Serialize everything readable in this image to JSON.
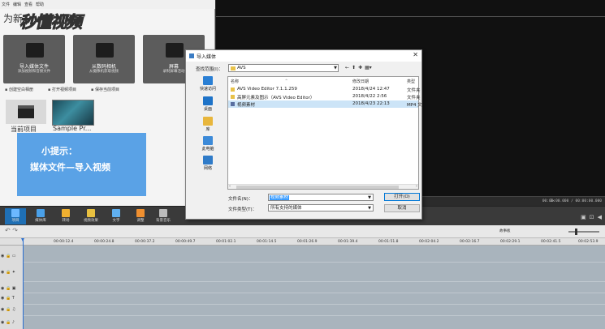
{
  "menubar": [
    "文件",
    "编辑",
    "查看",
    "帮助"
  ],
  "left_panel": {
    "heading_left": "为新",
    "heading_right": "择源",
    "tiles": [
      {
        "title": "导入媒体文件",
        "subtitle": "添加视频和音频文件"
      },
      {
        "title": "从数码相机",
        "subtitle": "从摄像机获取视频"
      },
      {
        "title": "屏幕",
        "subtitle": "录制屏幕活动"
      }
    ],
    "links": [
      "创建空白相册",
      "打开视频项目",
      "保存当前项目"
    ],
    "media": [
      {
        "label": "当前项目"
      },
      {
        "label": "Sample Pr..."
      }
    ]
  },
  "watermark": {
    "text": "秒懂视频"
  },
  "tip": {
    "line1": "小提示：",
    "line2": "媒体文件—导入视频"
  },
  "preview": {
    "speed": "1×",
    "time": "00:00:00.000 / 00:00:00.000"
  },
  "toolbar": {
    "items": [
      "项目",
      "媒体库",
      "转场",
      "视频效果",
      "文字",
      "调整",
      "背景音乐"
    ]
  },
  "timeline": {
    "zoom_label": "故事板",
    "ruler": [
      "00:00:12.4",
      "00:00:24.8",
      "00:00:37.2",
      "00:00:49.7",
      "00:01:02.1",
      "00:01:14.5",
      "00:01:26.9",
      "00:01:39.4",
      "00:01:51.8",
      "00:02:04.2",
      "00:02:16.7",
      "00:02:29.1",
      "00:02:41.5",
      "00:02:53.9"
    ]
  },
  "dialog": {
    "title": "导入媒体",
    "close": "✕",
    "lookin_label": "查找范围(I)：",
    "lookin_value": "AVS",
    "places": [
      "快速访问",
      "桌面",
      "库",
      "此电脑",
      "网络"
    ],
    "columns": {
      "name": "名称",
      "date": "修改日期",
      "type": "类型"
    },
    "files": [
      {
        "name": "AVS Video Editor 7.1.1.259",
        "date": "2018/4/24 12:47",
        "type": "文件夹",
        "kind": "folder"
      },
      {
        "name": "高屏元素及图示（AVS Video Editor）",
        "date": "2018/4/22 2:56",
        "type": "文件夹",
        "kind": "folder"
      },
      {
        "name": "视频素材",
        "date": "2018/4/23 22:13",
        "type": "MP4 文",
        "kind": "video"
      }
    ],
    "filename_label": "文件名(N)：",
    "filename_value": "视频素材",
    "filetype_label": "文件类型(T)：",
    "filetype_value": "所有支持的媒体",
    "open_button": "打开(O)",
    "cancel_button": "取消"
  },
  "colors": {
    "accent": "#1f6fb4",
    "tip_bg": "#5aa2e6",
    "selection": "#cce4f7"
  }
}
